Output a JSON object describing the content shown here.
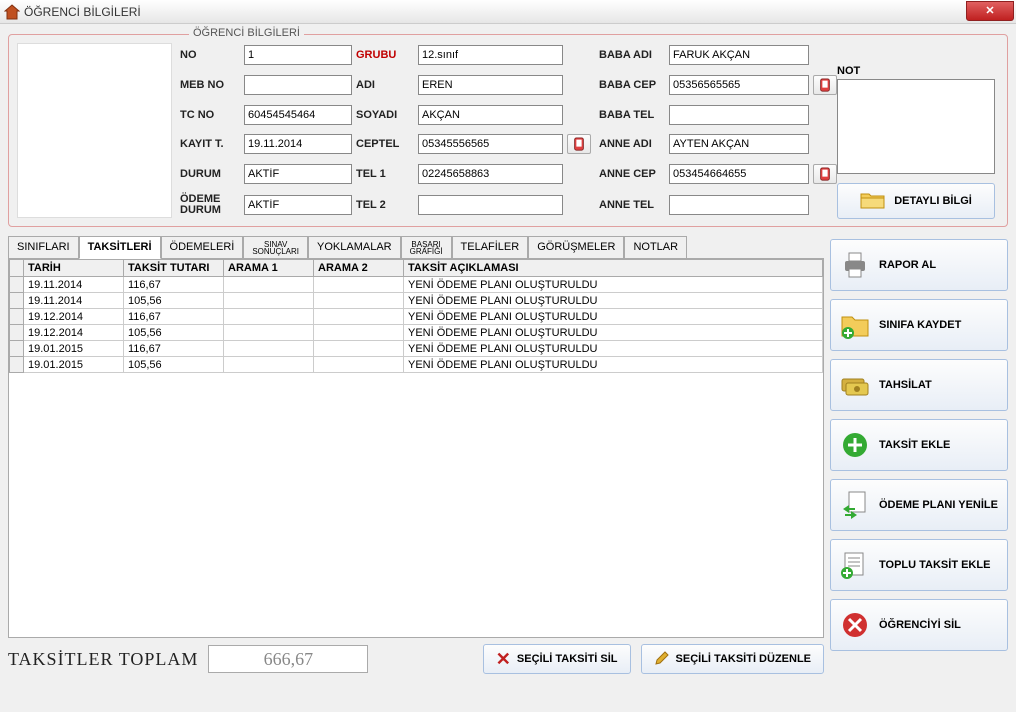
{
  "window": {
    "title": "ÖĞRENCİ BİLGİLERİ"
  },
  "group_legend": "ÖĞRENCİ BİLGİLERİ",
  "labels": {
    "no": "NO",
    "mebno": "MEB NO",
    "tcno": "TC NO",
    "kayitt": "KAYIT T.",
    "durum": "DURUM",
    "odemedurum": "ÖDEME DURUM",
    "grubu": "GRUBU",
    "adi": "ADI",
    "soyadi": "SOYADI",
    "ceptel": "CEPTEL",
    "tel1": "TEL 1",
    "tel2": "TEL 2",
    "babaadi": "BABA ADI",
    "babacep": "BABA CEP",
    "babatel": "BABA TEL",
    "anneadi": "ANNE ADI",
    "annecep": "ANNE CEP",
    "annetel": "ANNE TEL",
    "not": "NOT"
  },
  "values": {
    "no": "1",
    "mebno": "",
    "tcno": "60454545464",
    "kayitt": "19.11.2014",
    "durum": "AKTİF",
    "odemedurum": "AKTİF",
    "grubu": "12.sınıf",
    "adi": "EREN",
    "soyadi": "AKÇAN",
    "ceptel": "05345556565",
    "tel1": "02245658863",
    "tel2": "",
    "babaadi": "FARUK AKÇAN",
    "babacep": "05356565565",
    "babatel": "",
    "anneadi": "AYTEN AKÇAN",
    "annecep": "053454664655",
    "annetel": ""
  },
  "buttons": {
    "detayli": "DETAYLI BİLGİ",
    "rapor": "RAPOR AL",
    "sinifakaydet": "SINIFA KAYDET",
    "tahsilat": "TAHSİLAT",
    "taksitekle": "TAKSİT EKLE",
    "odemeplani": "ÖDEME PLANI YENİLE",
    "toplutaksit": "TOPLU TAKSİT EKLE",
    "ogrenciyisil": "ÖĞRENCİYİ SİL",
    "secilisil": "SEÇİLİ TAKSİTİ SİL",
    "seciliduz": "SEÇİLİ TAKSİTİ DÜZENLE"
  },
  "tabs": [
    "SINIFLARI",
    "TAKSİTLERİ",
    "ÖDEMELERİ",
    "SINAV SONUÇLARI",
    "YOKLAMALAR",
    "BAŞARI GRAFİĞİ",
    "TELAFİLER",
    "GÖRÜŞMELER",
    "NOTLAR"
  ],
  "active_tab": 1,
  "grid": {
    "headers": [
      "TARİH",
      "TAKSİT TUTARI",
      "ARAMA 1",
      "ARAMA 2",
      "TAKSİT AÇIKLAMASI"
    ],
    "rows": [
      [
        "19.11.2014",
        "116,67",
        "",
        "",
        "YENİ ÖDEME PLANI OLUŞTURULDU"
      ],
      [
        "19.11.2014",
        "105,56",
        "",
        "",
        "YENİ ÖDEME PLANI OLUŞTURULDU"
      ],
      [
        "19.12.2014",
        "116,67",
        "",
        "",
        "YENİ ÖDEME PLANI OLUŞTURULDU"
      ],
      [
        "19.12.2014",
        "105,56",
        "",
        "",
        "YENİ ÖDEME PLANI OLUŞTURULDU"
      ],
      [
        "19.01.2015",
        "116,67",
        "",
        "",
        "YENİ ÖDEME PLANI OLUŞTURULDU"
      ],
      [
        "19.01.2015",
        "105,56",
        "",
        "",
        "YENİ ÖDEME PLANI OLUŞTURULDU"
      ]
    ]
  },
  "total": {
    "label": "TAKSİTLER TOPLAM",
    "value": "666,67"
  }
}
